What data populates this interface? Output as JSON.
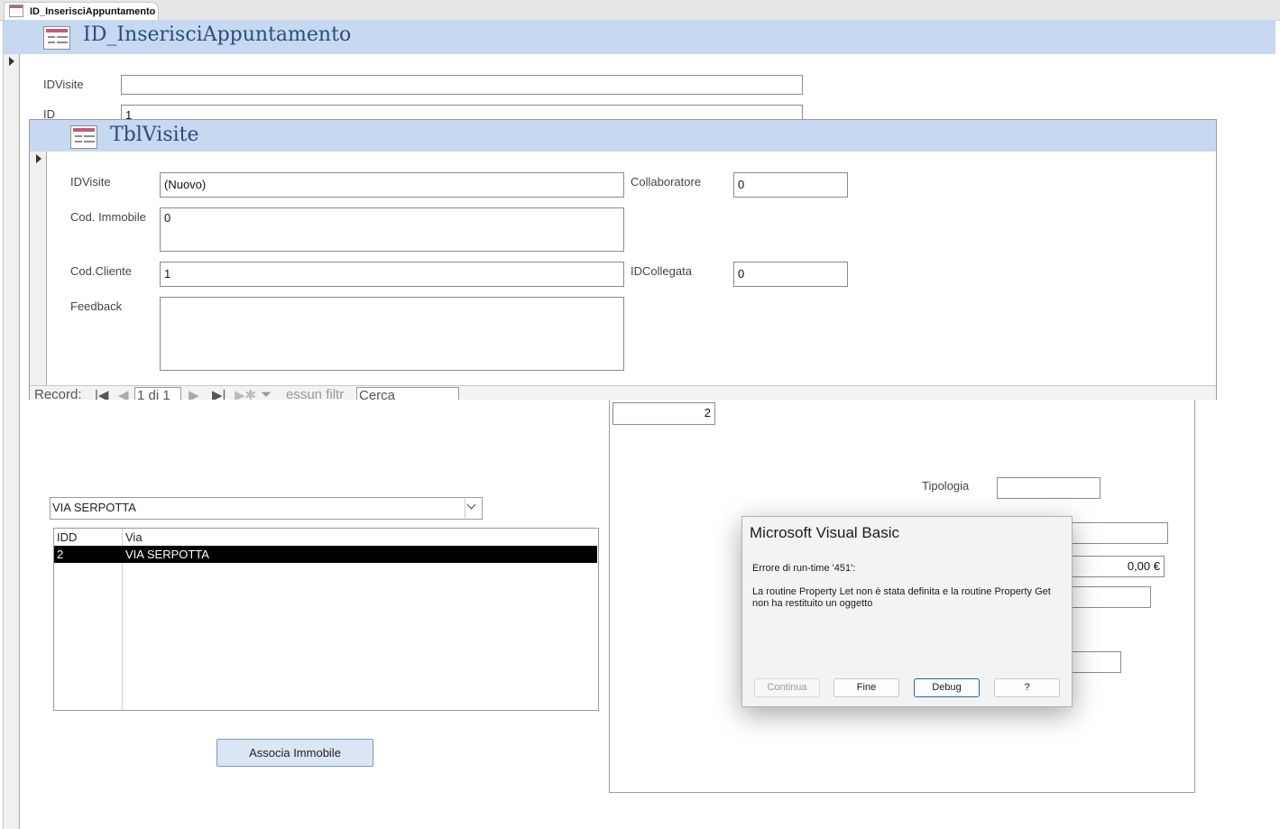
{
  "tab": {
    "title": "ID_InserisciAppuntamento"
  },
  "main_form": {
    "title": "ID_InserisciAppuntamento",
    "fields": {
      "idvisite": {
        "label": "IDVisite",
        "value": ""
      },
      "id": {
        "label": "ID",
        "value": "1"
      }
    }
  },
  "subform": {
    "title": "TblVisite",
    "fields": {
      "idvisite": {
        "label": "IDVisite",
        "value": "(Nuovo)"
      },
      "cod_immobile": {
        "label": "Cod. Immobile",
        "value": "0"
      },
      "cod_cliente": {
        "label": "Cod.Cliente",
        "value": "1"
      },
      "feedback": {
        "label": "Feedback",
        "value": ""
      },
      "collaboratore": {
        "label": "Collaboratore",
        "value": "0"
      },
      "idcollegata": {
        "label": "IDCollegata",
        "value": "0"
      }
    },
    "navigation": {
      "record_label": "Record:",
      "position": "1 di 1",
      "filter_text": "essun filtr",
      "search_value": "Cerca"
    }
  },
  "lower": {
    "combo_value": "VIA SERPOTTA",
    "listbox": {
      "headers": [
        "IDD",
        "Via"
      ],
      "rows": [
        {
          "idd": "2",
          "via": "VIA SERPOTTA"
        }
      ]
    },
    "associa_button": "Associa Immobile",
    "right_panel": {
      "number_value": "2",
      "tipologia_label": "Tipologia",
      "tipologia_value": "",
      "price_value": "0,00 €"
    }
  },
  "dialog": {
    "title": "Microsoft Visual Basic",
    "error_line": "Errore di run-time '451':",
    "message_line1": "La routine Property Let non è stata definita e la routine Property Get",
    "message_line2": "non ha restituito un oggetto",
    "buttons": {
      "continua": "Continua",
      "fine": "Fine",
      "debug": "Debug",
      "help": "?"
    }
  }
}
